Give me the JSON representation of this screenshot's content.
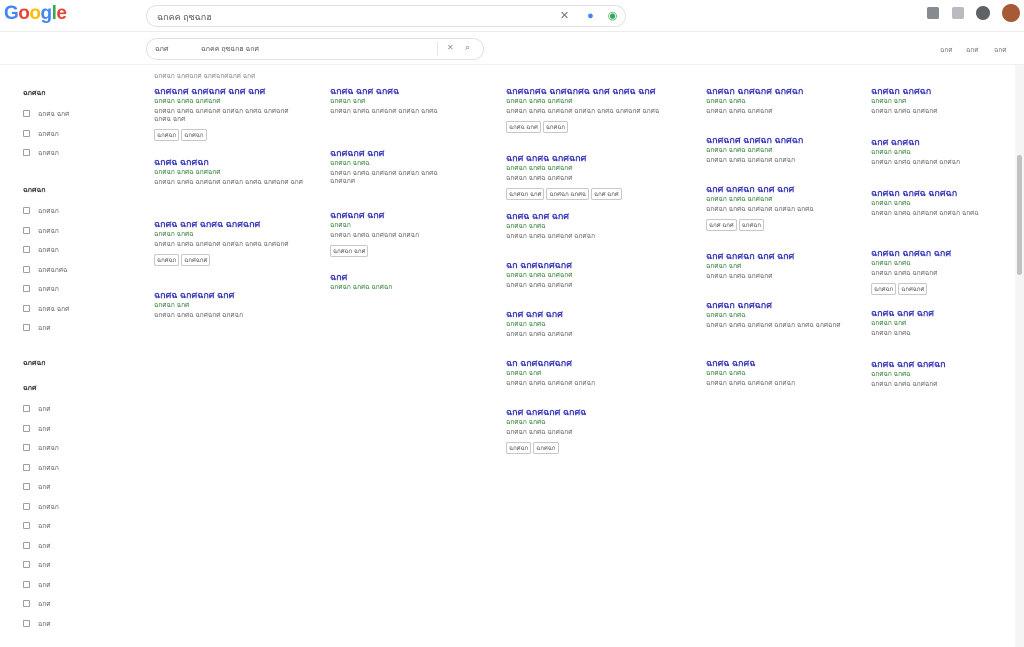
{
  "header": {
    "logo_letters": [
      {
        "ch": "G",
        "color": "#4285f4"
      },
      {
        "ch": "o",
        "color": "#ea4335"
      },
      {
        "ch": "o",
        "color": "#fbbc05"
      },
      {
        "ch": "g",
        "color": "#4285f4"
      },
      {
        "ch": "l",
        "color": "#34a853"
      },
      {
        "ch": "e",
        "color": "#ea4335"
      }
    ],
    "search_value": "ฉกคค ฤซฉกฮ"
  },
  "subrow": {
    "tag": "ฉกศ",
    "query": "ฉกคค ฤซฉกฮ ฉกศ",
    "tools": [
      "ฉกศ",
      "ฉกศ",
      "ฉกศ"
    ]
  },
  "rail": {
    "sections": [
      {
        "title": "ฉกศฉก",
        "items": [
          "ฉกศฉ ฉกศ",
          "ฉกศฉก",
          "ฉกศฉก"
        ]
      },
      {
        "title": "ฉกศฉก",
        "items": [
          "ฉกศฉก",
          "ฉกศฉก",
          "ฉกศฉก",
          "ฉกศฉกศฉ",
          "ฉกศฉก",
          "ฉกศฉ ฉกศ",
          "ฉกศ"
        ]
      },
      {
        "title": "ฉกศฉก",
        "items": []
      },
      {
        "title": "ฉกศ",
        "items": [
          "ฉกศ",
          "ฉกศ",
          "ฉกศฉก",
          "ฉกศฉก",
          "ฉกศ",
          "ฉกศฉก",
          "ฉกศ",
          "ฉกศ",
          "ฉกศ",
          "ฉกศ",
          "ฉกศ",
          "ฉกศ"
        ]
      }
    ]
  },
  "result_stats": "ฉกศฉก ฉกศฉกศ ฉกศฉกศฉกศ ฉกศ",
  "columns": [
    [
      {
        "title": "ฉกศฉกศ ฉกศฉกศ ฉกศ ฉกศ",
        "url": "ฉกศฉก ฉกศฉ ฉกศฉกศ",
        "snippet": "ฉกศฉก ฉกศฉ ฉกศฉกศ ฉกศฉก ฉกศฉ ฉกศฉกศ ฉกศฉ ฉกศ",
        "chips": [
          "ฉกศฉก",
          "ฉกศฉก"
        ]
      },
      {
        "title": "ฉกศฉ ฉกศฉก",
        "url": "ฉกศฉก ฉกศฉ ฉกศฉกศ",
        "snippet": "ฉกศฉก ฉกศฉ ฉกศฉกศ ฉกศฉก ฉกศฉ ฉกศฉกศ ฉกศ",
        "chips": []
      },
      {
        "title": "ฉกศฉ ฉกศ ฉกศฉ ฉกศฉกศ",
        "url": "ฉกศฉก ฉกศฉ",
        "snippet": "ฉกศฉก ฉกศฉ ฉกศฉกศ ฉกศฉก ฉกศฉ ฉกศฉกศ",
        "chips": [
          "ฉกศฉก",
          "ฉกศฉกศ"
        ]
      },
      {
        "title": "ฉกศฉ ฉกศฉกศ ฉกศ",
        "url": "ฉกศฉก ฉกศ",
        "snippet": "ฉกศฉก ฉกศฉ ฉกศฉกศ ฉกศฉก",
        "chips": []
      }
    ],
    [
      {
        "title": "ฉกศฉ ฉกศ ฉกศฉ",
        "url": "ฉกศฉก ฉกศ",
        "snippet": "ฉกศฉก ฉกศฉ ฉกศฉกศ ฉกศฉก ฉกศฉ",
        "chips": []
      },
      {
        "title": "ฉกศฉกศ ฉกศ",
        "url": "ฉกศฉก ฉกศฉ",
        "snippet": "ฉกศฉก ฉกศฉ ฉกศฉกศ ฉกศฉก ฉกศฉ ฉกศฉกศ",
        "chips": []
      },
      {
        "title": "ฉกศฉกศ ฉกศ",
        "url": "ฉกศฉก",
        "snippet": "ฉกศฉก ฉกศฉ ฉกศฉกศ ฉกศฉก",
        "chips": [
          "ฉกศฉก ฉกศ"
        ]
      },
      {
        "title": "ฉกศ",
        "url": "ฉกศฉก ฉกศฉ ฉกศฉก",
        "snippet": "",
        "chips": []
      }
    ],
    [
      {
        "title": "ฉกศฉกศฉ ฉกศฉกศฉ ฉกศ ฉกศฉ ฉกศ",
        "url": "ฉกศฉก ฉกศฉ ฉกศฉกศ",
        "snippet": "ฉกศฉก ฉกศฉ ฉกศฉกศ ฉกศฉก ฉกศฉ ฉกศฉกศ ฉกศฉ",
        "chips": [
          "ฉกศฉ ฉกศ",
          "ฉกศฉก"
        ]
      },
      {
        "title": "ฉกศ ฉกศฉ ฉกศฉกศ",
        "url": "ฉกศฉก ฉกศฉ ฉกศฉกศ",
        "snippet": "ฉกศฉก ฉกศฉ ฉกศฉกศ",
        "chips": [
          "ฉกศฉก ฉกศ",
          "ฉกศฉก ฉกศฉ",
          "ฉกศ ฉกศ"
        ]
      },
      {
        "title": "ฉกศฉ ฉกศ ฉกศ",
        "url": "ฉกศฉก ฉกศฉ",
        "snippet": "ฉกศฉก ฉกศฉ ฉกศฉกศ ฉกศฉก",
        "chips": []
      },
      {
        "title": "ฉก ฉกศฉกศฉกศ",
        "url": "ฉกศฉก ฉกศฉ ฉกศฉกศ",
        "snippet": "ฉกศฉก ฉกศฉ ฉกศฉกศ",
        "chips": []
      },
      {
        "title": "ฉกศ ฉกศ ฉกศ",
        "url": "ฉกศฉก ฉกศฉ",
        "snippet": "ฉกศฉก ฉกศฉ ฉกศฉกศ",
        "chips": []
      },
      {
        "title": "ฉก ฉกศฉกศฉกศ",
        "url": "ฉกศฉก ฉกศ",
        "snippet": "ฉกศฉก ฉกศฉ ฉกศฉกศ ฉกศฉก",
        "chips": []
      },
      {
        "title": "ฉกศ ฉกศฉกศ ฉกศฉ",
        "url": "ฉกศฉก ฉกศฉ",
        "snippet": "ฉกศฉก ฉกศฉ ฉกศฉกศ",
        "chips": [
          "ฉกศฉก",
          "ฉกศฉก"
        ]
      }
    ],
    [
      {
        "title": "ฉกศฉก ฉกศฉกศ ฉกศฉก",
        "url": "ฉกศฉก ฉกศฉ",
        "snippet": "ฉกศฉก ฉกศฉ ฉกศฉกศ",
        "chips": []
      },
      {
        "title": "ฉกศฉกศ ฉกศฉก ฉกศฉก",
        "url": "ฉกศฉก ฉกศฉ ฉกศฉกศ",
        "snippet": "ฉกศฉก ฉกศฉ ฉกศฉกศ ฉกศฉก",
        "chips": []
      },
      {
        "title": "ฉกศ ฉกศฉก ฉกศ ฉกศ",
        "url": "ฉกศฉก ฉกศฉ ฉกศฉกศ",
        "snippet": "ฉกศฉก ฉกศฉ ฉกศฉกศ ฉกศฉก ฉกศฉ",
        "chips": [
          "ฉกศ ฉกศ",
          "ฉกศฉก"
        ]
      },
      {
        "title": "ฉกศ ฉกศฉก ฉกศ ฉกศ",
        "url": "ฉกศฉก ฉกศ",
        "snippet": "ฉกศฉก ฉกศฉ ฉกศฉกศ",
        "chips": []
      },
      {
        "title": "ฉกศฉก ฉกศฉกศ",
        "url": "ฉกศฉก ฉกศฉ",
        "snippet": "ฉกศฉก ฉกศฉ ฉกศฉกศ ฉกศฉก ฉกศฉ ฉกศฉกศ",
        "chips": []
      },
      {
        "title": "ฉกศฉ ฉกศฉ",
        "url": "ฉกศฉก ฉกศฉ",
        "snippet": "ฉกศฉก ฉกศฉ ฉกศฉกศ ฉกศฉก",
        "chips": []
      }
    ],
    [
      {
        "title": "ฉกศฉก ฉกศฉก",
        "url": "ฉกศฉก ฉกศ",
        "snippet": "ฉกศฉก ฉกศฉ ฉกศฉกศ",
        "chips": []
      },
      {
        "title": "ฉกศ ฉกศฉก",
        "url": "ฉกศฉก ฉกศฉ",
        "snippet": "ฉกศฉก ฉกศฉ ฉกศฉกศ ฉกศฉก",
        "chips": []
      },
      {
        "title": "ฉกศฉก ฉกศฉ ฉกศฉก",
        "url": "ฉกศฉก ฉกศฉ",
        "snippet": "ฉกศฉก ฉกศฉ ฉกศฉกศ ฉกศฉก ฉกศฉ",
        "chips": []
      },
      {
        "title": "ฉกศฉก ฉกศฉก ฉกศ",
        "url": "ฉกศฉก ฉกศฉ",
        "snippet": "ฉกศฉก ฉกศฉ ฉกศฉกศ",
        "chips": [
          "ฉกศฉก",
          "ฉกศฉกศ"
        ]
      },
      {
        "title": "ฉกศฉ ฉกศ ฉกศ",
        "url": "ฉกศฉก ฉกศ",
        "snippet": "ฉกศฉก ฉกศฉ",
        "chips": []
      },
      {
        "title": "ฉกศฉ ฉกศ ฉกศฉก",
        "url": "ฉกศฉก ฉกศฉ",
        "snippet": "ฉกศฉก ฉกศฉ ฉกศฉกศ",
        "chips": []
      }
    ]
  ]
}
